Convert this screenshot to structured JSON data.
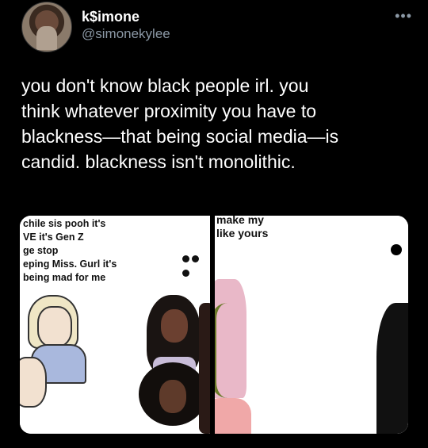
{
  "author": {
    "display_name": "k$imone",
    "handle": "@simonekylee",
    "more_label": "•••"
  },
  "tweet": {
    "text": "you don't know black people irl. you\nthink whatever proximity you have to\nblackness—that being social media—is\ncandid. blackness isn't monolithic."
  },
  "media": {
    "left_panel_text": "chile sis pooh it's\nVE it's Gen Z\nge stop\neping Miss. Gurl it's\n being mad for me",
    "right_panel_text": "make my\nlike yours"
  },
  "colors": {
    "background": "#000000",
    "text": "#ffffff",
    "secondary_text": "#8b98a5"
  }
}
